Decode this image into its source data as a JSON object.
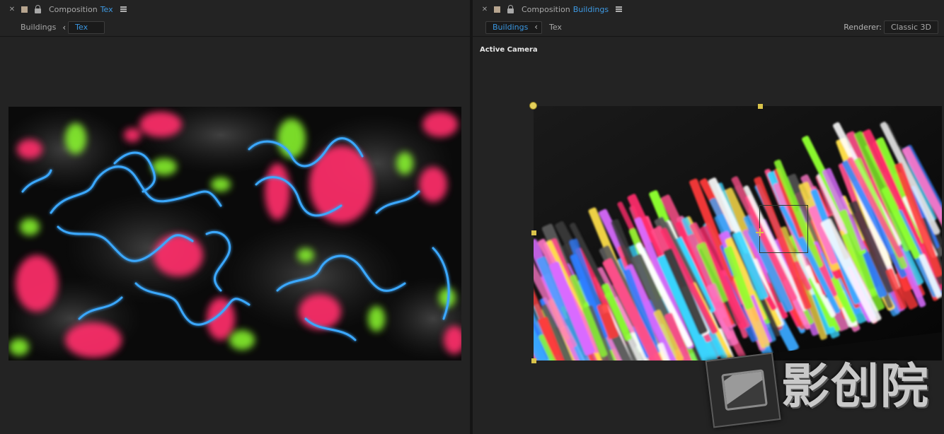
{
  "left_panel": {
    "tab": {
      "prefix": "Composition",
      "name": "Tex"
    },
    "nav": {
      "items": [
        "Buildings",
        "Tex"
      ],
      "active": "Tex"
    }
  },
  "right_panel": {
    "tab": {
      "prefix": "Composition",
      "name": "Buildings"
    },
    "nav": {
      "items": [
        "Buildings",
        "Tex"
      ],
      "active": "Buildings"
    },
    "renderer": {
      "label": "Renderer:",
      "value": "Classic 3D"
    },
    "view_label": "Active Camera"
  },
  "watermark": {
    "text": "影创院"
  },
  "colors": {
    "accent_blue": "#3a96e0",
    "neon_pink": "#ff2d6b",
    "neon_blue": "#3aa8ff",
    "neon_green": "#8dff2e",
    "handle_yellow": "#d9c34a"
  },
  "icons": {
    "close": "close-icon",
    "label_color": "label-color-swatch",
    "lock": "lock-icon",
    "menu": "panel-menu-icon",
    "nav_back": "chevron-left-icon"
  }
}
